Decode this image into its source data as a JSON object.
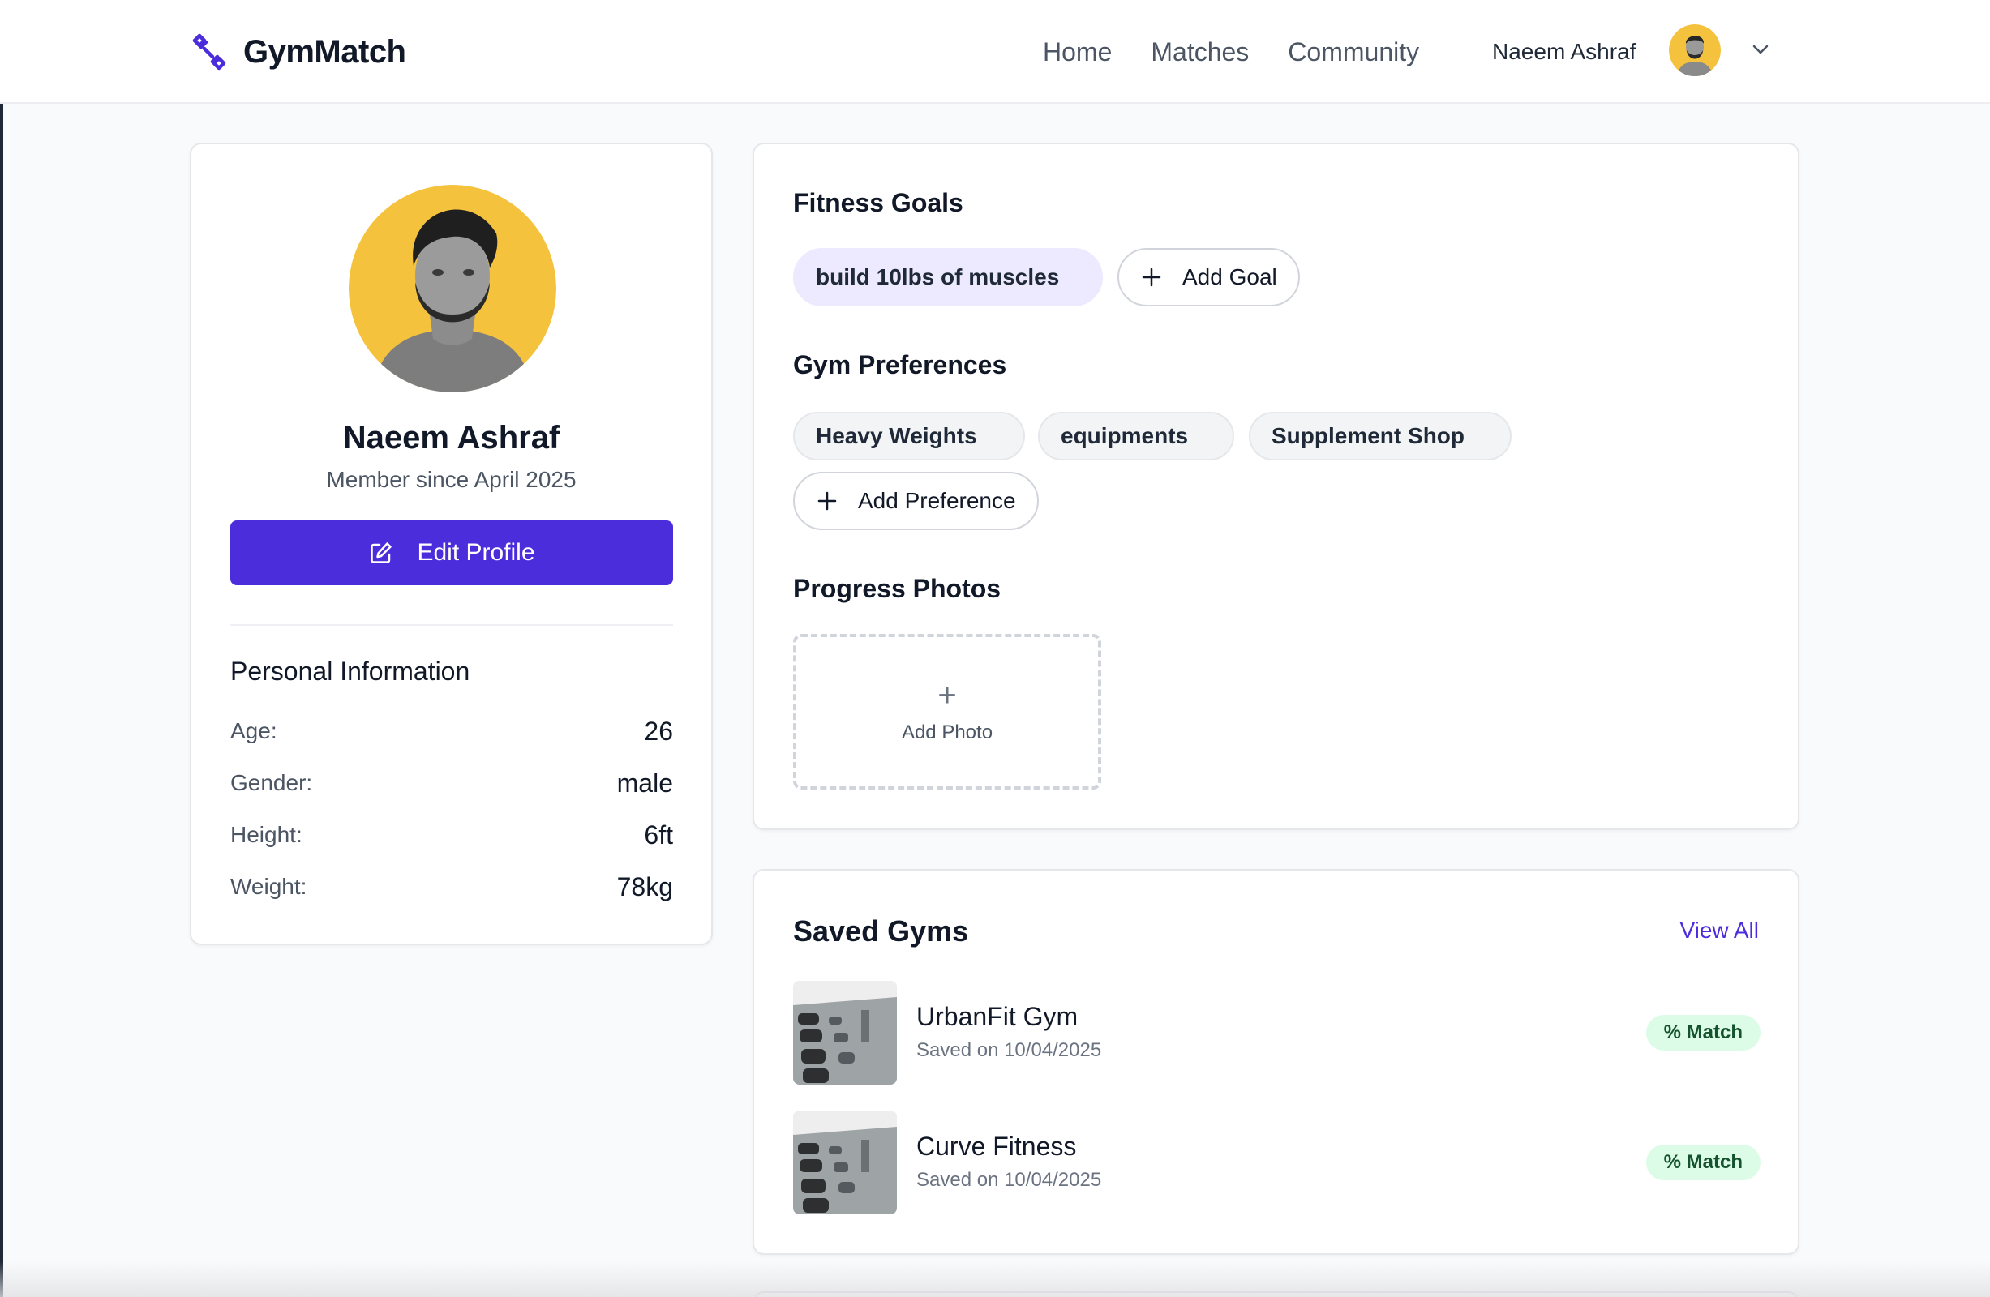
{
  "app": {
    "name": "GymMatch",
    "logo_icon": "dumbbell-icon",
    "accent_color": "#4c2ddb"
  },
  "nav": {
    "items": [
      "Home",
      "Matches",
      "Community"
    ]
  },
  "user_menu": {
    "name": "Naeem Ashraf",
    "avatar_icon": "avatar",
    "dropdown_icon": "chevron-down-icon"
  },
  "profile": {
    "name": "Naeem Ashraf",
    "member_since": "Member since April 2025",
    "edit_button": "Edit Profile",
    "edit_icon": "edit-icon",
    "personal_info": {
      "title": "Personal Information",
      "rows": [
        {
          "label": "Age:",
          "value": "26"
        },
        {
          "label": "Gender:",
          "value": "male"
        },
        {
          "label": "Height:",
          "value": "6ft"
        },
        {
          "label": "Weight:",
          "value": "78kg"
        }
      ]
    }
  },
  "fitness_goals": {
    "title": "Fitness Goals",
    "goals": [
      "build 10lbs of muscles"
    ],
    "add_label": "Add Goal"
  },
  "gym_preferences": {
    "title": "Gym Preferences",
    "items": [
      "Heavy Weights",
      "equipments",
      "Supplement Shop"
    ],
    "add_label": "Add Preference"
  },
  "progress_photos": {
    "title": "Progress Photos",
    "add_icon": "+",
    "add_label": "Add Photo"
  },
  "saved_gyms": {
    "title": "Saved Gyms",
    "view_all": "View All",
    "items": [
      {
        "name": "UrbanFit Gym",
        "saved": "Saved on 10/04/2025",
        "match": "% Match"
      },
      {
        "name": "Curve Fitness",
        "saved": "Saved on 10/04/2025",
        "match": "% Match"
      }
    ],
    "badge_color": "#dcfce7"
  }
}
